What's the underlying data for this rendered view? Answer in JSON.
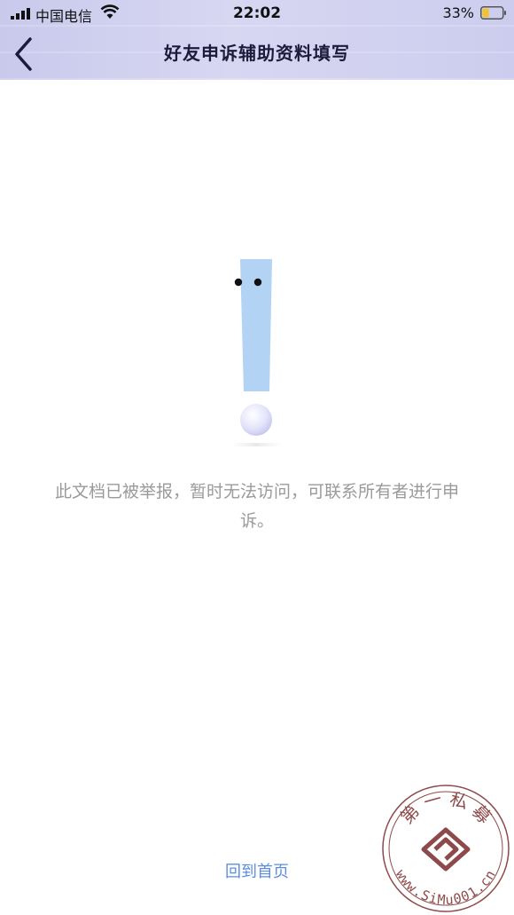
{
  "status_bar": {
    "carrier": "中国电信",
    "time": "22:02",
    "battery_percent": "33%",
    "battery_level": 0.33,
    "icons": [
      "signal-icon",
      "wifi-icon",
      "battery-icon"
    ]
  },
  "header": {
    "title": "好友申诉辅助资料填写",
    "back_icon": "chevron-left-icon"
  },
  "main": {
    "illustration": "exclamation-illustration",
    "message": "此文档已被举报，暂时无法访问，可联系所有者进行申诉。",
    "home_link": "回到首页"
  },
  "watermark": {
    "text_top": "第 一 私 募",
    "text_bottom": "www.SiMu001.cn"
  },
  "colors": {
    "header_bg": "#d0d0ef",
    "title": "#1d1b3c",
    "message": "#9a9a9a",
    "link": "#5b8de4",
    "exclamation": "#b3d3f5",
    "stamp": "#8e4a4a"
  }
}
